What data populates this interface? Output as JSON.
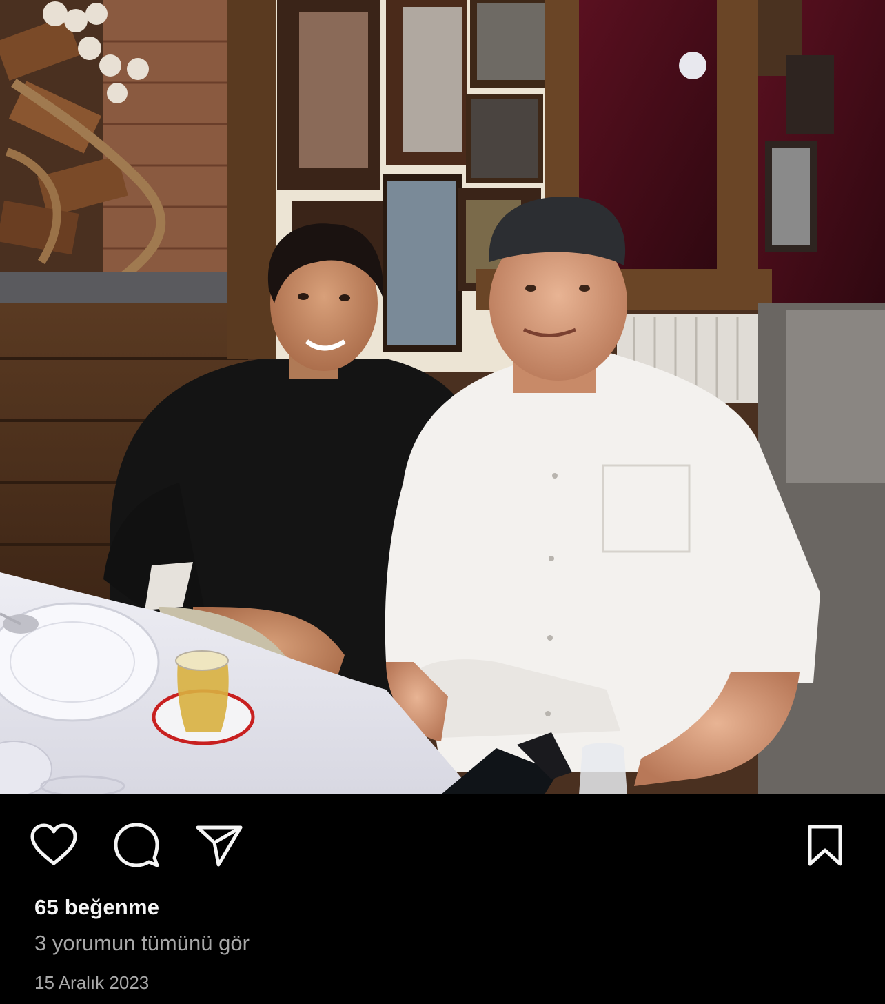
{
  "post": {
    "photo_icon": "photo-image",
    "likes_text": "65 beğenme",
    "view_comments_text": "3 yorumun tümünü gör",
    "date_text": "15 Aralık 2023"
  },
  "actions": {
    "like_icon": "heart-icon",
    "comment_icon": "comment-bubble-icon",
    "share_icon": "paper-plane-icon",
    "save_icon": "bookmark-icon"
  },
  "colors": {
    "background": "#000000",
    "primary_text": "#f5f5f5",
    "secondary_text": "#a8a8a8"
  }
}
